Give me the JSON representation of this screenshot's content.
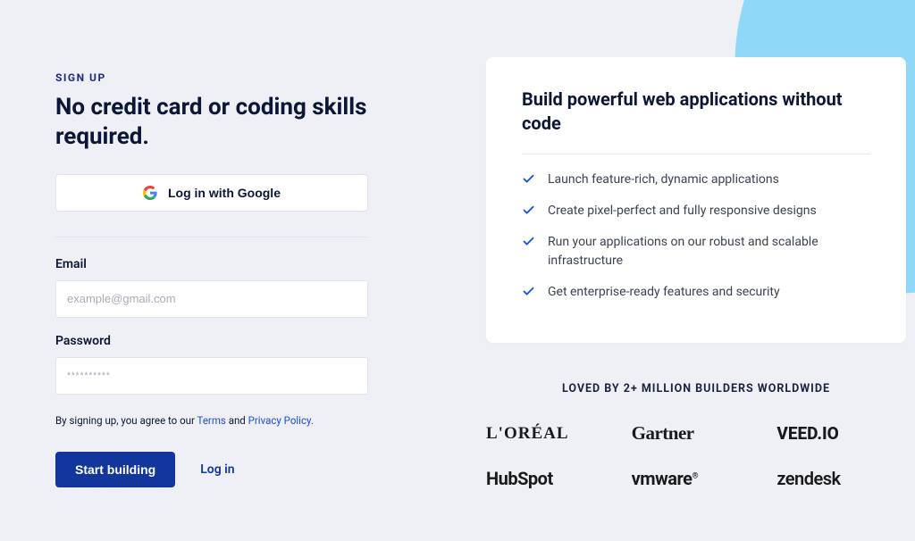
{
  "signup": {
    "eyebrow": "SIGN UP",
    "headline": "No credit card or coding skills required.",
    "google_label": "Log in with Google",
    "email_label": "Email",
    "email_placeholder": "example@gmail.com",
    "password_label": "Password",
    "password_placeholder": "**********",
    "consent_prefix": "By signing up, you agree to our ",
    "terms_label": "Terms",
    "consent_mid": " and ",
    "privacy_label": "Privacy Policy.",
    "submit_label": "Start building",
    "login_label": "Log in"
  },
  "benefits": {
    "title": "Build powerful web applications without code",
    "items": [
      "Launch feature-rich, dynamic applications",
      "Create pixel-perfect and fully responsive designs",
      "Run your applications on our robust and scalable infrastructure",
      "Get enterprise-ready features and security"
    ]
  },
  "social": {
    "heading": "LOVED BY 2+ MILLION BUILDERS WORLDWIDE",
    "logos": [
      "L'ORÉAL",
      "Gartner",
      "VEED.IO",
      "HubSpot",
      "vmware",
      "zendesk"
    ]
  }
}
